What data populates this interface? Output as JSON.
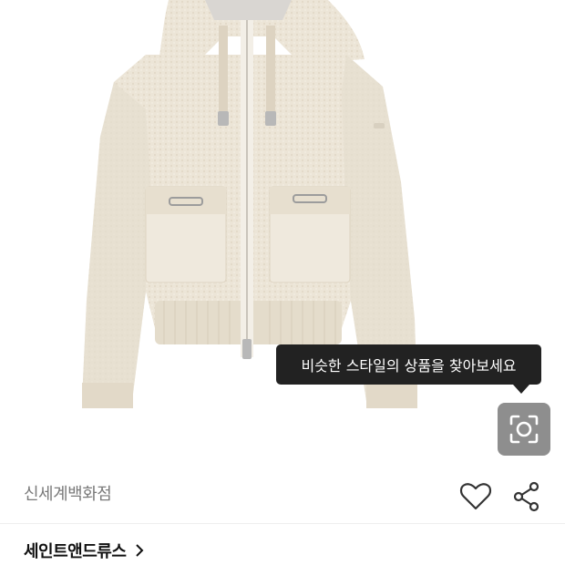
{
  "product_image": {
    "alt": "",
    "colors": {
      "fabric": "#ece5d7",
      "fabric_shade": "#ddd3c1",
      "hood_lining": "#d9d6d2",
      "hardware": "#b8b8b8"
    }
  },
  "visual_search": {
    "tooltip": "비슷한 스타일의 상품을 찾아보세요",
    "icon": "camera-lens-icon"
  },
  "seller": {
    "name": "신세계백화점"
  },
  "actions": {
    "like_icon": "heart-outline-icon",
    "share_icon": "share-icon"
  },
  "brand": {
    "name": "세인트앤드류스",
    "icon": "chevron-right-icon"
  }
}
